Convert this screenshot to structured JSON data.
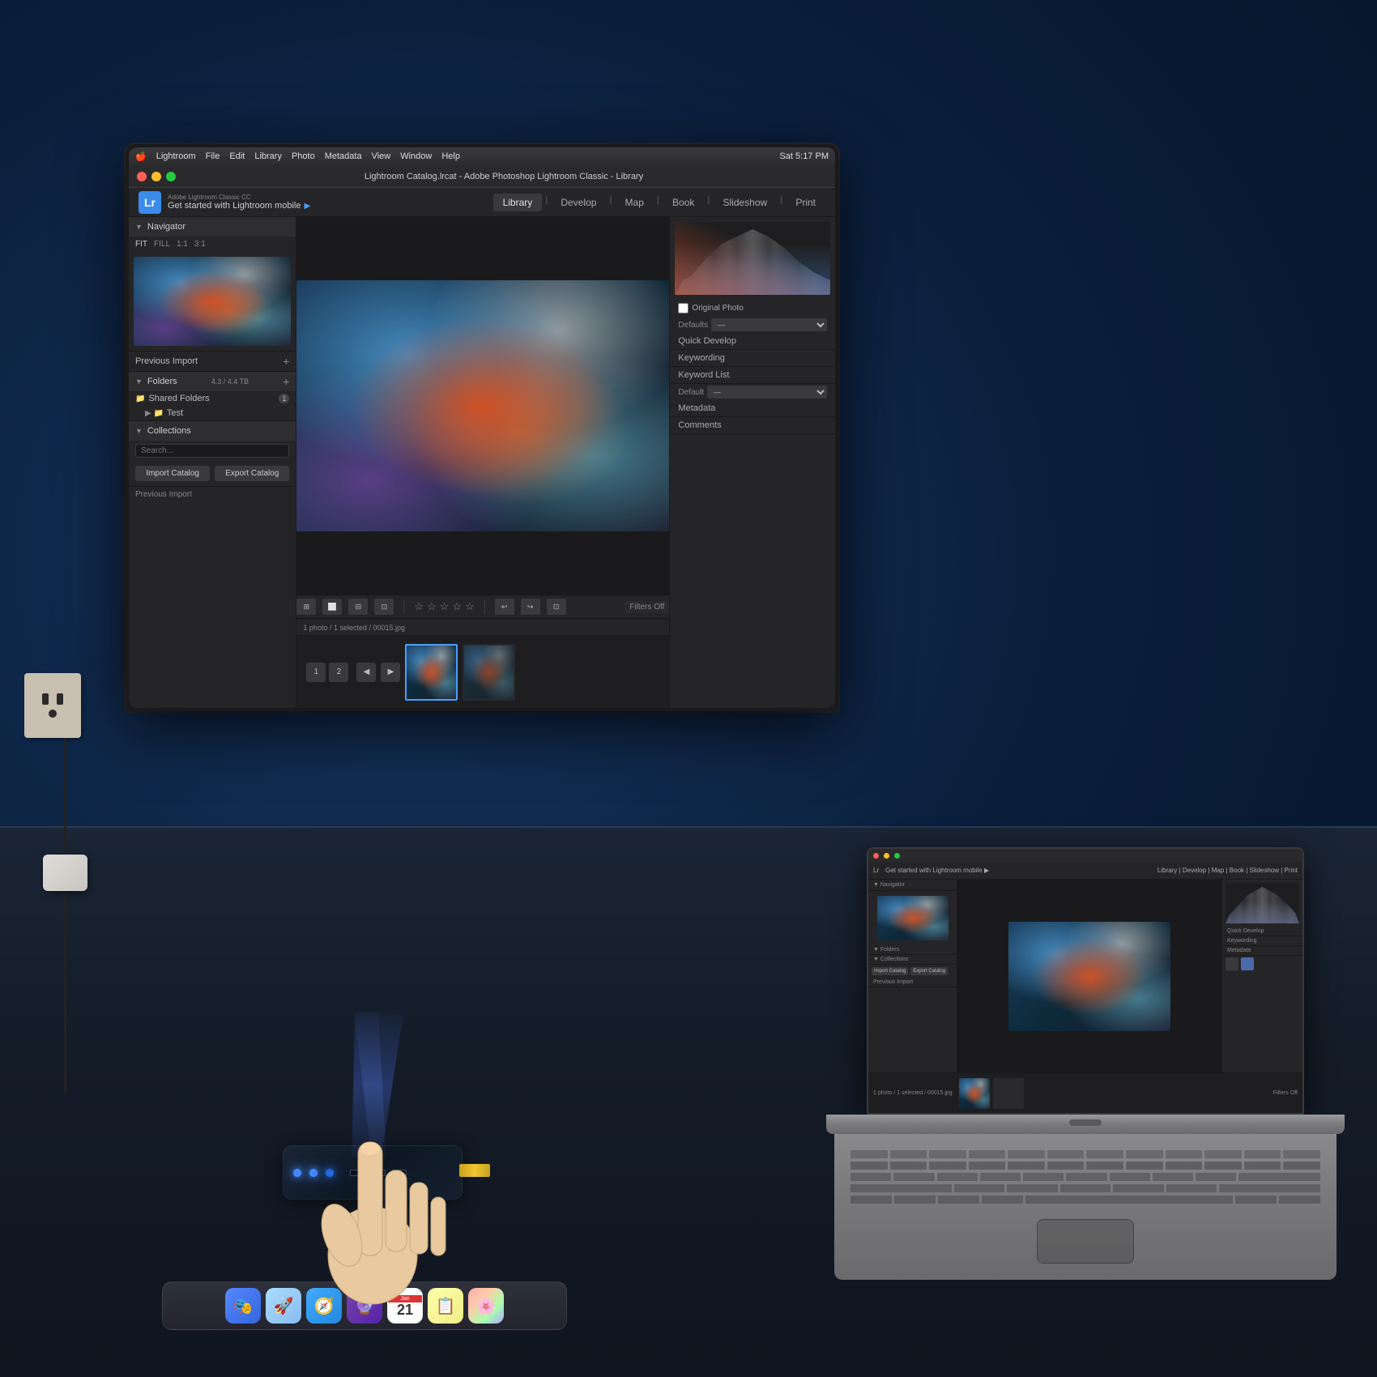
{
  "app": {
    "name": "Lightroom",
    "title": "Lightroom Catalog.lrcat - Adobe Photoshop Lightroom Classic - Library",
    "time": "Sat 5:17 PM",
    "branding_sub": "Adobe Lightroom Classic CC",
    "branding_main": "Get started with Lightroom mobile",
    "menu": [
      "Lightroom",
      "File",
      "Edit",
      "Library",
      "Photo",
      "Metadata",
      "View",
      "Window",
      "Help"
    ]
  },
  "modules": {
    "tabs": [
      "Library",
      "Develop",
      "Map",
      "Book",
      "Slideshow",
      "Print"
    ],
    "active": "Library"
  },
  "left_panel": {
    "navigator": {
      "title": "Navigator",
      "fit_options": [
        "FIT",
        "FILL",
        "1:1",
        "3:1"
      ]
    },
    "folders": {
      "title": "Folders",
      "info": "4.3 / 4.4 TB",
      "items": [
        {
          "name": "Shared Folders",
          "badge": "1"
        },
        {
          "name": "Test",
          "indent": true
        }
      ],
      "import_label": "Previous Import"
    },
    "collections": {
      "title": "Collections",
      "search_placeholder": "Search...",
      "import_btn": "Import Catalog",
      "export_btn": "Export Catalog"
    }
  },
  "right_panel": {
    "original_photo": "Original Photo",
    "items": [
      "Quick Develop",
      "Keywording",
      "Keyword List",
      "Metadata",
      "Comments"
    ],
    "defaults_label": "Defaults",
    "default_label": "Default"
  },
  "filmstrip": {
    "info": "1 photo / 1 selected / 00015.jpg",
    "nav_numbers": [
      "1",
      "2"
    ],
    "filters_off": "Filters Off"
  },
  "stars": [
    "★",
    "★",
    "★",
    "★",
    "★"
  ]
}
